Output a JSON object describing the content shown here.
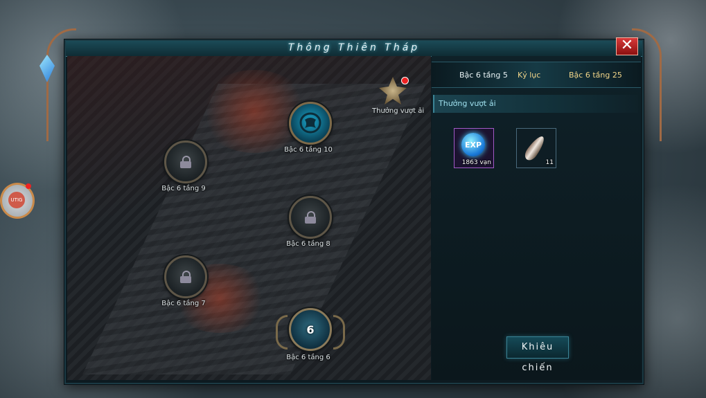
{
  "window": {
    "title": "Thông Thiên Tháp",
    "close_label": "✕"
  },
  "stage": {
    "nodes": [
      {
        "label": "Bậc 6 tầng 10",
        "state": "active",
        "icon": "dragon-emblem-icon"
      },
      {
        "label": "Bậc 6 tầng 9",
        "state": "locked",
        "icon": "lock-icon"
      },
      {
        "label": "Bậc 6 tầng 8",
        "state": "locked",
        "icon": "lock-icon"
      },
      {
        "label": "Bậc 6 tầng 7",
        "state": "locked",
        "icon": "lock-icon"
      },
      {
        "label": "Bậc 6 tầng 6",
        "state": "current",
        "number": "6"
      }
    ],
    "reward_button": {
      "label": "Thưởng vượt ải",
      "icon": "crest-icon",
      "has_notification": true
    }
  },
  "panel": {
    "record": {
      "current": "Bậc 6 tầng 5",
      "label": "Kỷ lục",
      "best": "Bậc 6 tầng 25"
    },
    "section_title": "Thưởng vượt ải",
    "rewards": [
      {
        "name": "exp",
        "icon_text": "EXP",
        "qty": "1863 vạn",
        "rarity": "epic"
      },
      {
        "name": "feather",
        "icon": "feather-icon",
        "qty": "11",
        "rarity": "normal"
      }
    ],
    "challenge_button": "Khiêu chiến"
  },
  "side_widget": {
    "label": "UTIG",
    "has_notification": true
  },
  "colors": {
    "accent_cyan": "#3b8496",
    "gold_text": "#f1d589",
    "close_red": "#d83a3a"
  }
}
